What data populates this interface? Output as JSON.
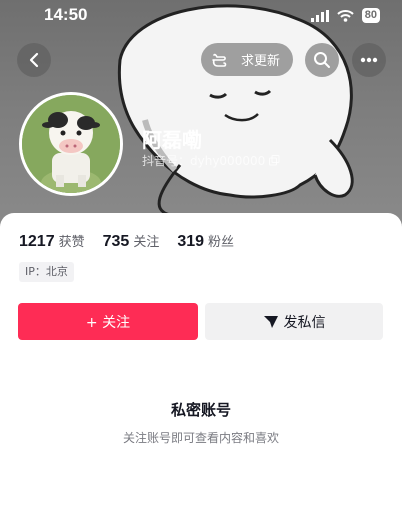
{
  "status_bar": {
    "time": "14:50",
    "battery": "80"
  },
  "header": {
    "back_icon": "chevron-left-icon",
    "update_label": "求更新",
    "search_icon": "search-icon",
    "more_icon": "more-dots-icon"
  },
  "profile": {
    "nickname": "阿磊嘞",
    "douyin_id": "抖音号：dyhy000000"
  },
  "stats": [
    {
      "value": "1217",
      "label": "获赞"
    },
    {
      "value": "735",
      "label": "关注"
    },
    {
      "value": "319",
      "label": "粉丝"
    }
  ],
  "ip": "IP：北京",
  "actions": {
    "follow_label": "+ 关注",
    "message_label": "发私信"
  },
  "private_notice": {
    "title": "私密账号",
    "subtitle": "关注账号即可查看内容和喜欢"
  },
  "colors": {
    "accent": "#fe2c55",
    "secondary_button": "#f1f1f2",
    "text_primary": "#161823",
    "text_secondary": "#7a7b82"
  }
}
